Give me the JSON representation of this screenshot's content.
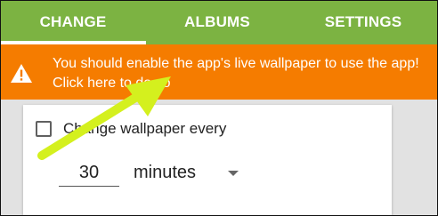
{
  "tabs": [
    {
      "label": "CHANGE",
      "active": true
    },
    {
      "label": "ALBUMS",
      "active": false
    },
    {
      "label": "SETTINGS",
      "active": false
    }
  ],
  "banner": {
    "icon": "warning-icon",
    "message": "You should enable the app's live wallpaper to use the app! Click here to do so"
  },
  "settings": {
    "change_label": "Change wallpaper every",
    "change_enabled": false,
    "interval_value": "30",
    "interval_unit": "minutes"
  },
  "colors": {
    "tab_bar": "#7cb342",
    "banner": "#f57c00",
    "annotation_arrow": "#d4f01e"
  }
}
